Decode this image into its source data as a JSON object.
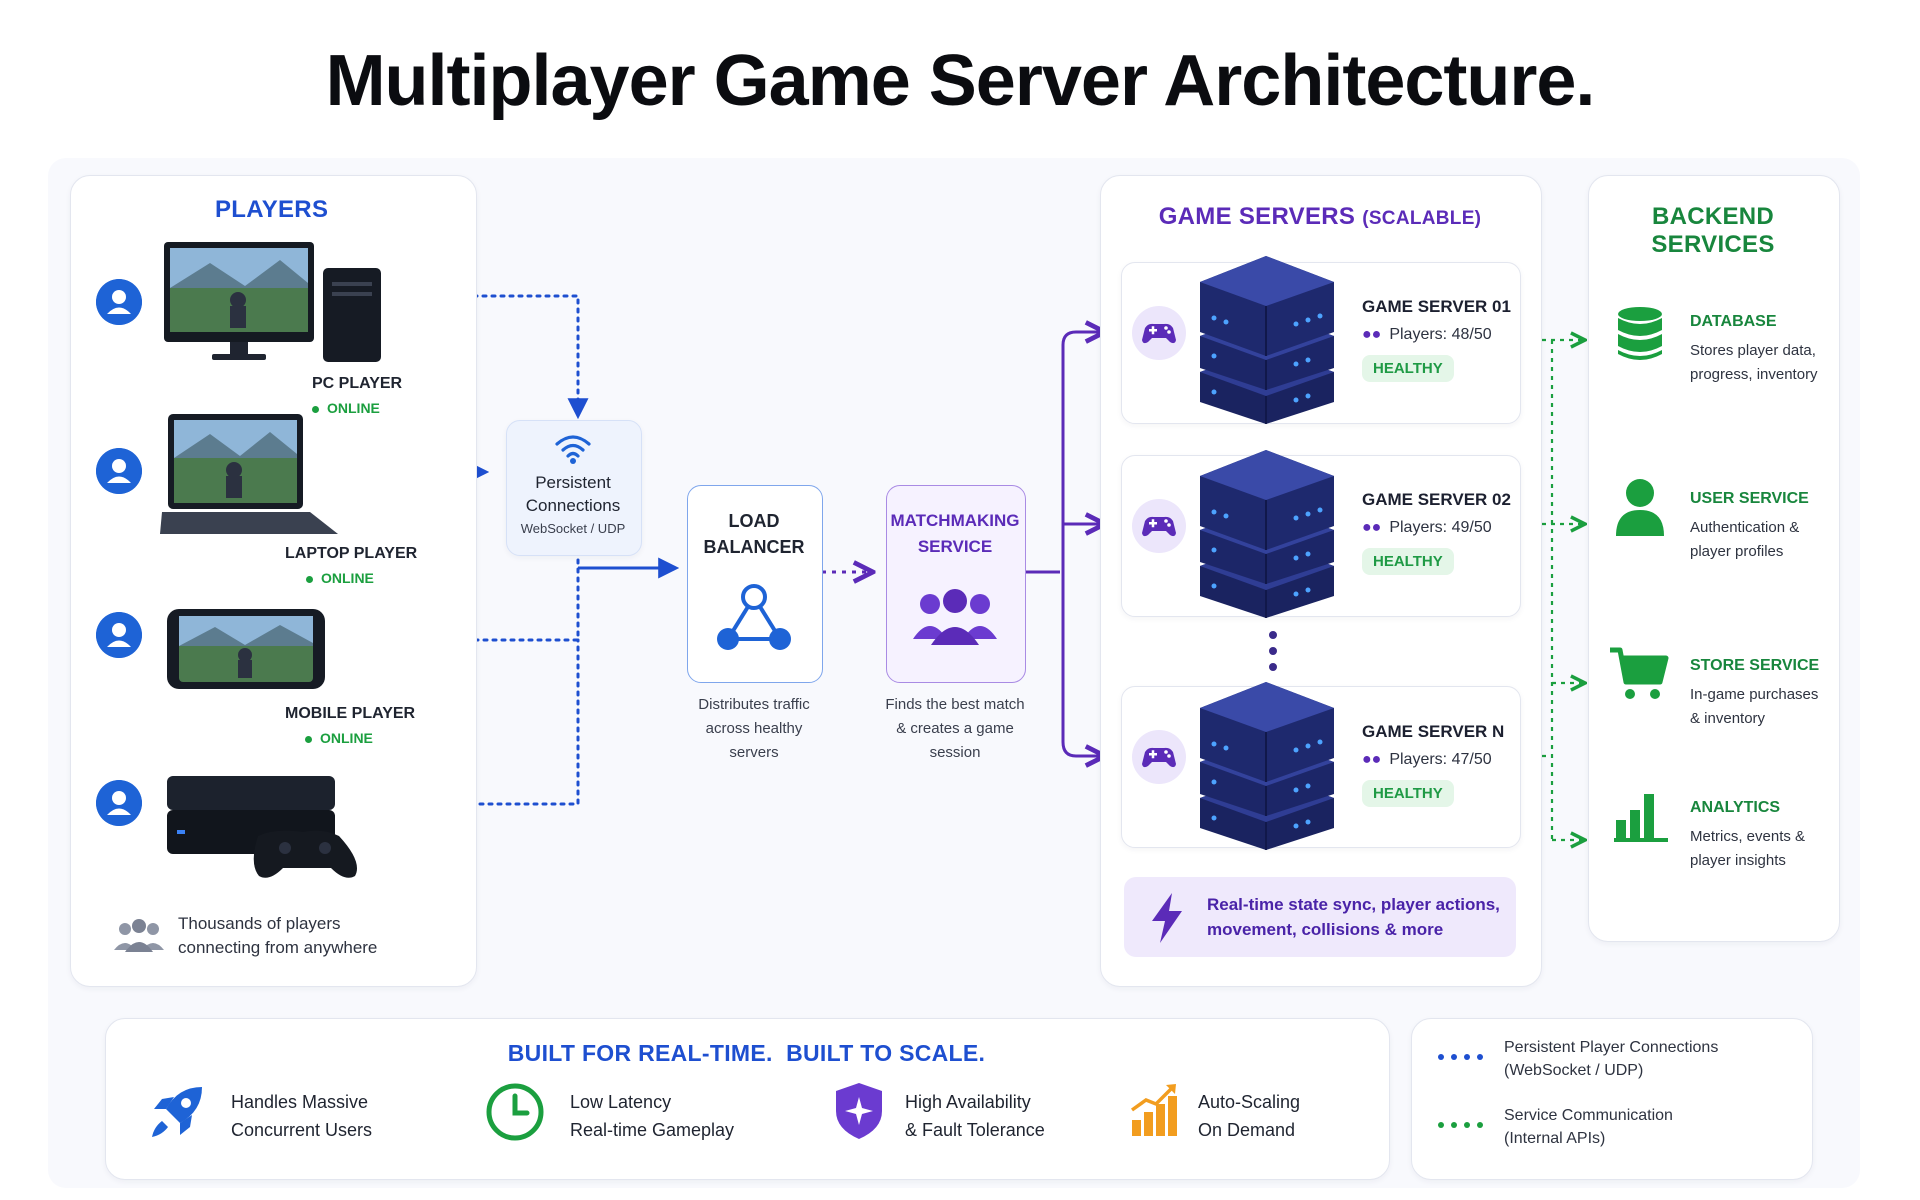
{
  "title": "Multiplayer Game Server Architecture.",
  "players": {
    "heading": "PLAYERS",
    "items": [
      {
        "label": "PC PLAYER",
        "status": "ONLINE"
      },
      {
        "label": "LAPTOP PLAYER",
        "status": "ONLINE"
      },
      {
        "label": "MOBILE PLAYER",
        "status": "ONLINE"
      },
      {
        "label": "",
        "status": ""
      }
    ],
    "footer_line1": "Thousands of players",
    "footer_line2": "connecting from anywhere"
  },
  "connections": {
    "line1": "Persistent",
    "line2": "Connections",
    "protocol": "WebSocket / UDP"
  },
  "load_balancer": {
    "line1": "LOAD",
    "line2": "BALANCER",
    "desc": [
      "Distributes traffic",
      "across healthy",
      "servers"
    ]
  },
  "matchmaking": {
    "line1": "MATCHMAKING",
    "line2": "SERVICE",
    "desc": [
      "Finds the best match",
      "& creates a game",
      "session"
    ]
  },
  "game_servers": {
    "heading": "GAME SERVERS",
    "heading_suffix": "(SCALABLE)",
    "servers": [
      {
        "name": "GAME SERVER 01",
        "players": "Players: 48/50",
        "status": "HEALTHY"
      },
      {
        "name": "GAME SERVER 02",
        "players": "Players: 49/50",
        "status": "HEALTHY"
      },
      {
        "name": "GAME SERVER N",
        "players": "Players: 47/50",
        "status": "HEALTHY"
      }
    ],
    "sync_line1": "Real-time state sync, player actions,",
    "sync_line2": "movement, collisions & more"
  },
  "backend": {
    "heading": "BACKEND SERVICES",
    "services": [
      {
        "name": "DATABASE",
        "desc1": "Stores player data,",
        "desc2": "progress, inventory",
        "icon": "database-icon"
      },
      {
        "name": "USER SERVICE",
        "desc1": "Authentication &",
        "desc2": "player profiles",
        "icon": "user-icon"
      },
      {
        "name": "STORE SERVICE",
        "desc1": "In-game purchases",
        "desc2": "& inventory",
        "icon": "cart-icon"
      },
      {
        "name": "ANALYTICS",
        "desc1": "Metrics, events &",
        "desc2": "player insights",
        "icon": "bar-chart-icon"
      }
    ]
  },
  "features": {
    "heading": "BUILT FOR REAL-TIME.  BUILT TO SCALE.",
    "items": [
      {
        "line1": "Handles Massive",
        "line2": "Concurrent Users",
        "icon": "rocket-icon"
      },
      {
        "line1": "Low Latency",
        "line2": "Real-time Gameplay",
        "icon": "clock-icon"
      },
      {
        "line1": "High Availability",
        "line2": "& Fault Tolerance",
        "icon": "shield-icon"
      },
      {
        "line1": "Auto-Scaling",
        "line2": "On Demand",
        "icon": "growth-chart-icon"
      }
    ]
  },
  "legend": {
    "items": [
      {
        "line1": "Persistent Player Connections",
        "line2": "(WebSocket / UDP)",
        "color": "#1e4fd0"
      },
      {
        "line1": "Service Communication",
        "line2": "(Internal APIs)",
        "color": "#1b9f3f"
      }
    ]
  },
  "colors": {
    "blue": "#1e63d6",
    "purple": "#5b2bb8",
    "green": "#18863d",
    "navy": "#23307a"
  }
}
